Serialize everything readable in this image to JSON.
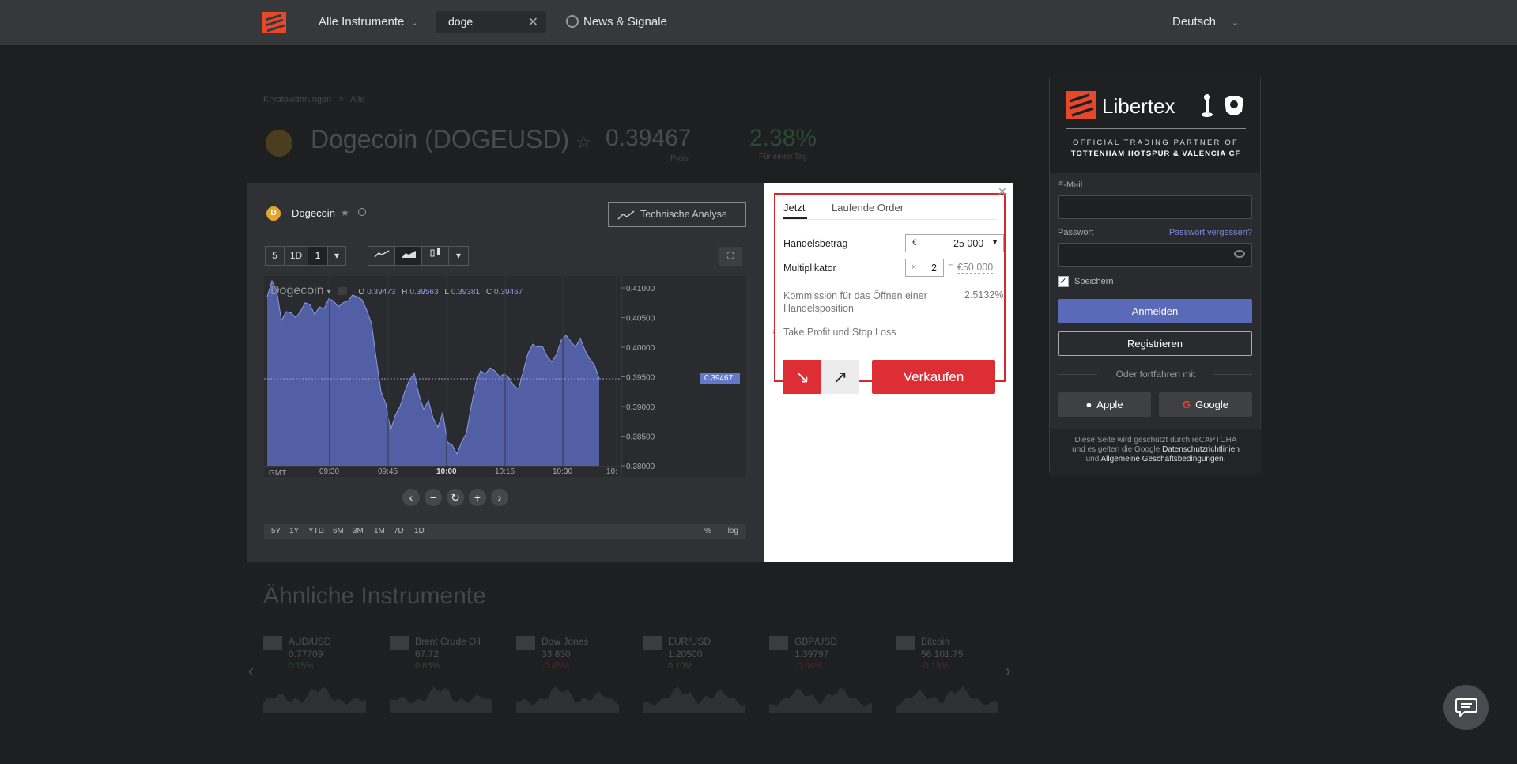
{
  "topbar": {
    "instruments_label": "Alle Instrumente",
    "search_value": "doge",
    "news_label": "News & Signale",
    "language": "Deutsch"
  },
  "background": {
    "breadcrumb_1": "Kryptowährungen",
    "breadcrumb_sep": ">",
    "breadcrumb_2": "Alle",
    "title": "Dogecoin (DOGEUSD)",
    "price": "0.39467",
    "price_label": "Preis",
    "change": "2.38%",
    "change_label": "Für einen Tag",
    "similar_title": "Ähnliche Instrumente",
    "similar": [
      {
        "name": "AUD/USD",
        "price": "0.77709",
        "change": "0.15%",
        "color": "#2b4a33"
      },
      {
        "name": "Brent Crude Oil",
        "price": "67.72",
        "change": "0.86%",
        "color": "#2b4a33"
      },
      {
        "name": "Dow Jones",
        "price": "33 830",
        "change": "-0.45%",
        "color": "#5a2226"
      },
      {
        "name": "EUR/USD",
        "price": "1.20500",
        "change": "0.10%",
        "color": "#2b4a33"
      },
      {
        "name": "GBP/USD",
        "price": "1.39797",
        "change": "-0.04%",
        "color": "#5a2226"
      },
      {
        "name": "Bitcoin",
        "price": "56 101.75",
        "change": "-0.19%",
        "color": "#5a2226"
      }
    ]
  },
  "login": {
    "brand": "Libertex",
    "partner_line1": "OFFICIAL TRADING PARTNER OF",
    "partner_line2": "TOTTENHAM HOTSPUR & VALENCIA CF",
    "email_label": "E-Mail",
    "password_label": "Passwort",
    "forgot_label": "Passwort vergessen?",
    "remember_label": "Speichern",
    "login_button": "Anmelden",
    "register_button": "Registrieren",
    "or_text": "Oder fortfahren mit",
    "apple_button": "Apple",
    "google_button": "Google",
    "captcha_1": "Diese Seite wird geschützt durch reCAPTCHA",
    "captcha_2": "und es gelten die Google",
    "captcha_link1": "Datenschutzrichtlinien",
    "captcha_3": "und",
    "captcha_link2": "Allgemeine Geschäftsbedingungen",
    "captcha_end": "."
  },
  "chart_panel": {
    "instrument": "Dogecoin",
    "ta_button": "Technische Analyse",
    "period_buttons": [
      "5",
      "1D",
      "1"
    ],
    "chart_name": "Dogecoin",
    "ohlc": {
      "o_label": "O",
      "o": "0.39473",
      "h_label": "H",
      "h": "0.39563",
      "l_label": "L",
      "l": "0.39381",
      "c_label": "C",
      "c": "0.39467"
    },
    "current_price_tag": "0.39467",
    "timezone": "GMT",
    "ranges": [
      "5Y",
      "1Y",
      "YTD",
      "6M",
      "3M",
      "1M",
      "7D",
      "1D"
    ],
    "pct_label": "%",
    "log_label": "log"
  },
  "chart_data": {
    "type": "area",
    "title": "",
    "series": [
      {
        "name": "Dogecoin",
        "color": "#5a69b8"
      }
    ],
    "x_ticks": [
      "09:30",
      "09:45",
      "10:00",
      "10:15",
      "10:30",
      "10:"
    ],
    "y_ticks": [
      "0.41000",
      "0.40500",
      "0.40000",
      "0.39500",
      "0.39000",
      "0.38500",
      "0.38000"
    ],
    "ylim": [
      0.38,
      0.412
    ],
    "values": [
      0.4085,
      0.4112,
      0.4095,
      0.4045,
      0.406,
      0.4058,
      0.405,
      0.406,
      0.4075,
      0.4072,
      0.4055,
      0.4068,
      0.4065,
      0.4082,
      0.4078,
      0.4068,
      0.4075,
      0.4078,
      0.4088,
      0.4085,
      0.408,
      0.4062,
      0.404,
      0.398,
      0.3925,
      0.3905,
      0.386,
      0.3885,
      0.39,
      0.3925,
      0.3945,
      0.3955,
      0.392,
      0.3895,
      0.391,
      0.388,
      0.3865,
      0.389,
      0.384,
      0.3835,
      0.382,
      0.384,
      0.3855,
      0.39,
      0.394,
      0.396,
      0.3955,
      0.3965,
      0.396,
      0.395,
      0.3955,
      0.3948,
      0.3935,
      0.393,
      0.396,
      0.399,
      0.4005,
      0.4,
      0.4002,
      0.3985,
      0.3975,
      0.3988,
      0.4012,
      0.402,
      0.401,
      0.4,
      0.4015,
      0.3995,
      0.398,
      0.397,
      0.3947
    ],
    "last": 0.39467,
    "grid": false
  },
  "trade": {
    "tab_now": "Jetzt",
    "tab_orders": "Laufende Order",
    "amount_label": "Handelsbetrag",
    "currency": "€",
    "amount": "25 000",
    "multiplier_label": "Multiplikator",
    "mult_x": "×",
    "multiplier": "2",
    "eq": "=",
    "total": "€50 000",
    "commission_label": "Kommission für das Öffnen einer Handelsposition",
    "commission_value": "2.5132%",
    "tpsl_label": "Take Profit und Stop Loss",
    "sell_button": "Verkaufen"
  }
}
